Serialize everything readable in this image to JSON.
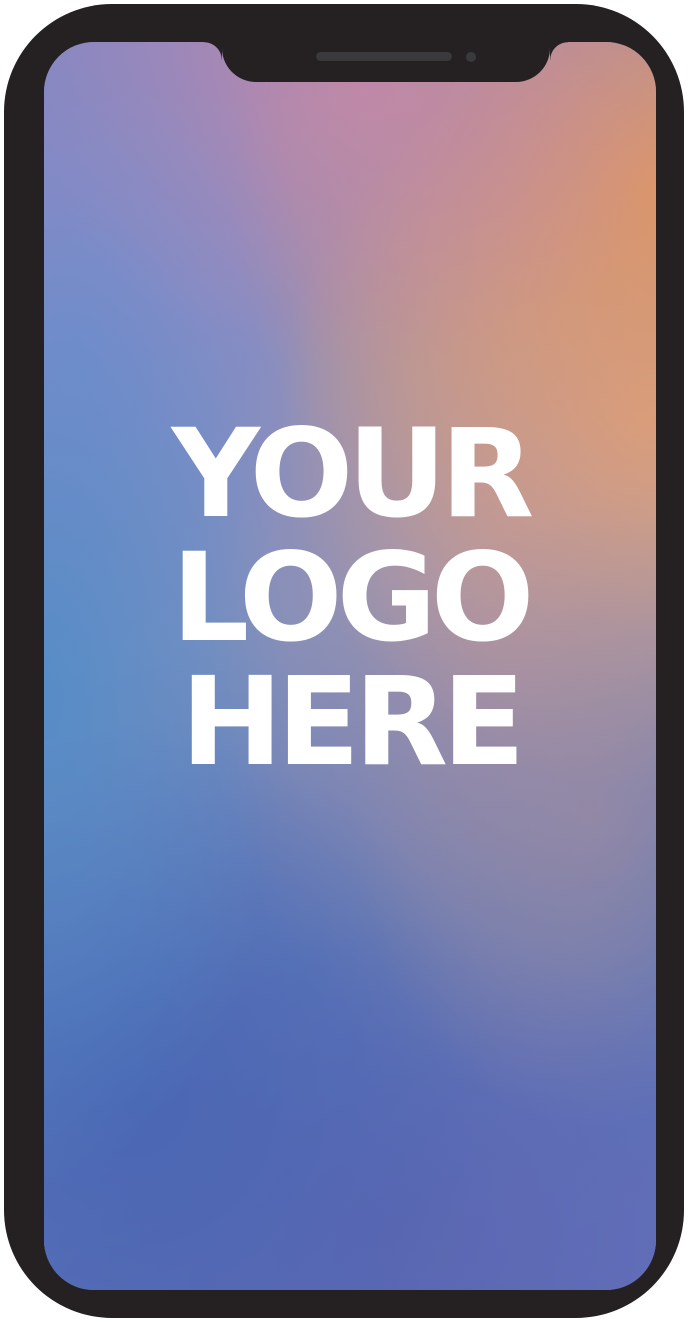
{
  "logo": {
    "line1": "YOUR",
    "line2": "LOGO",
    "line3": "HERE"
  },
  "colors": {
    "bezel": "#252122",
    "logo_text": "#ffffff",
    "gradient_warm": "#de9664",
    "gradient_blue": "#508cc8",
    "gradient_indigo": "#5a6cb6"
  }
}
